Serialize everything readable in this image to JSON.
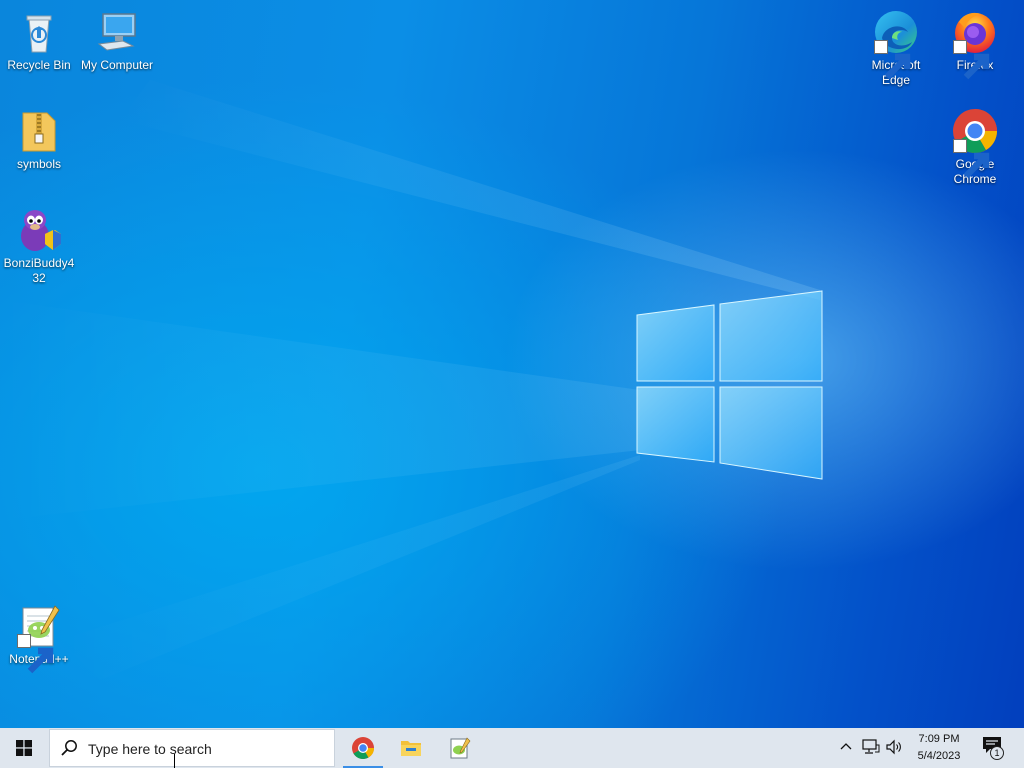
{
  "desktop": {
    "icons": [
      {
        "label": "Recycle Bin",
        "icon": "recycle-bin-icon"
      },
      {
        "label": "My Computer",
        "icon": "computer-icon"
      },
      {
        "label": "symbols",
        "icon": "zip-folder-icon"
      },
      {
        "label": "BonziBuddy432",
        "icon": "bonzibuddy-icon"
      },
      {
        "label": "Notepad++",
        "icon": "notepad-plus-plus-icon"
      },
      {
        "label": "Microsoft Edge",
        "icon": "edge-icon"
      },
      {
        "label": "Firefox",
        "icon": "firefox-icon"
      },
      {
        "label": "Google Chrome",
        "icon": "chrome-icon"
      }
    ]
  },
  "taskbar": {
    "search_placeholder": "Type here to search",
    "pinned_apps": [
      {
        "name": "Google Chrome",
        "icon": "chrome-icon",
        "active": true
      },
      {
        "name": "File Explorer",
        "icon": "file-explorer-icon",
        "active": false
      },
      {
        "name": "Notepad++",
        "icon": "notepad-plus-plus-icon",
        "active": false
      }
    ],
    "tray": {
      "clock_time": "7:09 PM",
      "clock_date": "5/4/2023",
      "notification_count": "1"
    }
  },
  "colors": {
    "desktop_blue": "#0a86dc",
    "taskbar": "#dfe6ee",
    "active_indicator": "#3a8ee6"
  }
}
